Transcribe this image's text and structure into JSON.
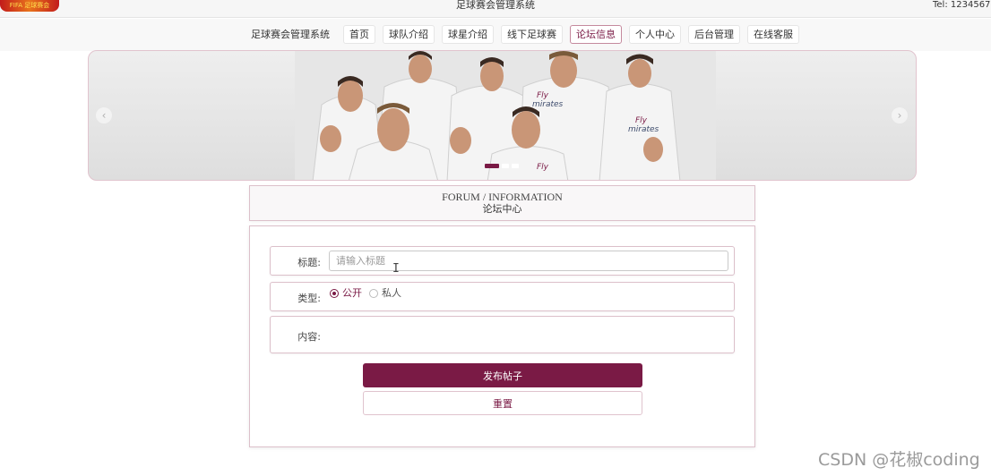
{
  "topbar": {
    "logo_text": "FIFA 足球赛会",
    "app_title": "足球赛会管理系统",
    "tel": "Tel: 1234567"
  },
  "nav": {
    "items": [
      {
        "label": "足球赛会管理系统"
      },
      {
        "label": "首页"
      },
      {
        "label": "球队介绍"
      },
      {
        "label": "球星介绍"
      },
      {
        "label": "线下足球赛"
      },
      {
        "label": "论坛信息",
        "active": true
      },
      {
        "label": "个人中心"
      },
      {
        "label": "后台管理"
      },
      {
        "label": "在线客服"
      }
    ]
  },
  "carousel": {
    "prev_icon": "chevron-left-icon",
    "next_icon": "chevron-right-icon",
    "image_description": "Real Madrid football players group photo",
    "active_slide": 1,
    "slide_count": 3
  },
  "section": {
    "title_en": "FORUM / INFORMATION",
    "title_zh": "论坛中心"
  },
  "form": {
    "title_label": "标题:",
    "title_placeholder": "请输入标题",
    "title_value": "",
    "type_label": "类型:",
    "type_options": [
      {
        "label": "公开",
        "checked": true
      },
      {
        "label": "私人",
        "checked": false
      }
    ],
    "content_label": "内容:",
    "submit_label": "发布帖子",
    "reset_label": "重置"
  },
  "colors": {
    "accent": "#7a1a45",
    "border": "#dcc0ca"
  },
  "watermark": "CSDN @花椒coding"
}
